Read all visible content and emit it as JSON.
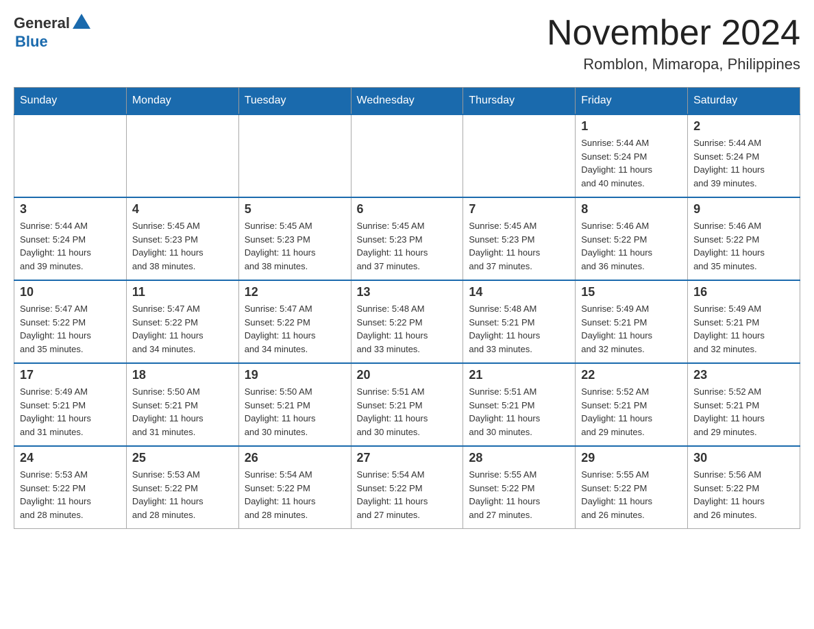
{
  "header": {
    "logo_general": "General",
    "logo_blue": "Blue",
    "month_title": "November 2024",
    "location": "Romblon, Mimaropa, Philippines"
  },
  "days_of_week": [
    "Sunday",
    "Monday",
    "Tuesday",
    "Wednesday",
    "Thursday",
    "Friday",
    "Saturday"
  ],
  "weeks": [
    [
      {
        "day": "",
        "info": ""
      },
      {
        "day": "",
        "info": ""
      },
      {
        "day": "",
        "info": ""
      },
      {
        "day": "",
        "info": ""
      },
      {
        "day": "",
        "info": ""
      },
      {
        "day": "1",
        "info": "Sunrise: 5:44 AM\nSunset: 5:24 PM\nDaylight: 11 hours\nand 40 minutes."
      },
      {
        "day": "2",
        "info": "Sunrise: 5:44 AM\nSunset: 5:24 PM\nDaylight: 11 hours\nand 39 minutes."
      }
    ],
    [
      {
        "day": "3",
        "info": "Sunrise: 5:44 AM\nSunset: 5:24 PM\nDaylight: 11 hours\nand 39 minutes."
      },
      {
        "day": "4",
        "info": "Sunrise: 5:45 AM\nSunset: 5:23 PM\nDaylight: 11 hours\nand 38 minutes."
      },
      {
        "day": "5",
        "info": "Sunrise: 5:45 AM\nSunset: 5:23 PM\nDaylight: 11 hours\nand 38 minutes."
      },
      {
        "day": "6",
        "info": "Sunrise: 5:45 AM\nSunset: 5:23 PM\nDaylight: 11 hours\nand 37 minutes."
      },
      {
        "day": "7",
        "info": "Sunrise: 5:45 AM\nSunset: 5:23 PM\nDaylight: 11 hours\nand 37 minutes."
      },
      {
        "day": "8",
        "info": "Sunrise: 5:46 AM\nSunset: 5:22 PM\nDaylight: 11 hours\nand 36 minutes."
      },
      {
        "day": "9",
        "info": "Sunrise: 5:46 AM\nSunset: 5:22 PM\nDaylight: 11 hours\nand 35 minutes."
      }
    ],
    [
      {
        "day": "10",
        "info": "Sunrise: 5:47 AM\nSunset: 5:22 PM\nDaylight: 11 hours\nand 35 minutes."
      },
      {
        "day": "11",
        "info": "Sunrise: 5:47 AM\nSunset: 5:22 PM\nDaylight: 11 hours\nand 34 minutes."
      },
      {
        "day": "12",
        "info": "Sunrise: 5:47 AM\nSunset: 5:22 PM\nDaylight: 11 hours\nand 34 minutes."
      },
      {
        "day": "13",
        "info": "Sunrise: 5:48 AM\nSunset: 5:22 PM\nDaylight: 11 hours\nand 33 minutes."
      },
      {
        "day": "14",
        "info": "Sunrise: 5:48 AM\nSunset: 5:21 PM\nDaylight: 11 hours\nand 33 minutes."
      },
      {
        "day": "15",
        "info": "Sunrise: 5:49 AM\nSunset: 5:21 PM\nDaylight: 11 hours\nand 32 minutes."
      },
      {
        "day": "16",
        "info": "Sunrise: 5:49 AM\nSunset: 5:21 PM\nDaylight: 11 hours\nand 32 minutes."
      }
    ],
    [
      {
        "day": "17",
        "info": "Sunrise: 5:49 AM\nSunset: 5:21 PM\nDaylight: 11 hours\nand 31 minutes."
      },
      {
        "day": "18",
        "info": "Sunrise: 5:50 AM\nSunset: 5:21 PM\nDaylight: 11 hours\nand 31 minutes."
      },
      {
        "day": "19",
        "info": "Sunrise: 5:50 AM\nSunset: 5:21 PM\nDaylight: 11 hours\nand 30 minutes."
      },
      {
        "day": "20",
        "info": "Sunrise: 5:51 AM\nSunset: 5:21 PM\nDaylight: 11 hours\nand 30 minutes."
      },
      {
        "day": "21",
        "info": "Sunrise: 5:51 AM\nSunset: 5:21 PM\nDaylight: 11 hours\nand 30 minutes."
      },
      {
        "day": "22",
        "info": "Sunrise: 5:52 AM\nSunset: 5:21 PM\nDaylight: 11 hours\nand 29 minutes."
      },
      {
        "day": "23",
        "info": "Sunrise: 5:52 AM\nSunset: 5:21 PM\nDaylight: 11 hours\nand 29 minutes."
      }
    ],
    [
      {
        "day": "24",
        "info": "Sunrise: 5:53 AM\nSunset: 5:22 PM\nDaylight: 11 hours\nand 28 minutes."
      },
      {
        "day": "25",
        "info": "Sunrise: 5:53 AM\nSunset: 5:22 PM\nDaylight: 11 hours\nand 28 minutes."
      },
      {
        "day": "26",
        "info": "Sunrise: 5:54 AM\nSunset: 5:22 PM\nDaylight: 11 hours\nand 28 minutes."
      },
      {
        "day": "27",
        "info": "Sunrise: 5:54 AM\nSunset: 5:22 PM\nDaylight: 11 hours\nand 27 minutes."
      },
      {
        "day": "28",
        "info": "Sunrise: 5:55 AM\nSunset: 5:22 PM\nDaylight: 11 hours\nand 27 minutes."
      },
      {
        "day": "29",
        "info": "Sunrise: 5:55 AM\nSunset: 5:22 PM\nDaylight: 11 hours\nand 26 minutes."
      },
      {
        "day": "30",
        "info": "Sunrise: 5:56 AM\nSunset: 5:22 PM\nDaylight: 11 hours\nand 26 minutes."
      }
    ]
  ]
}
